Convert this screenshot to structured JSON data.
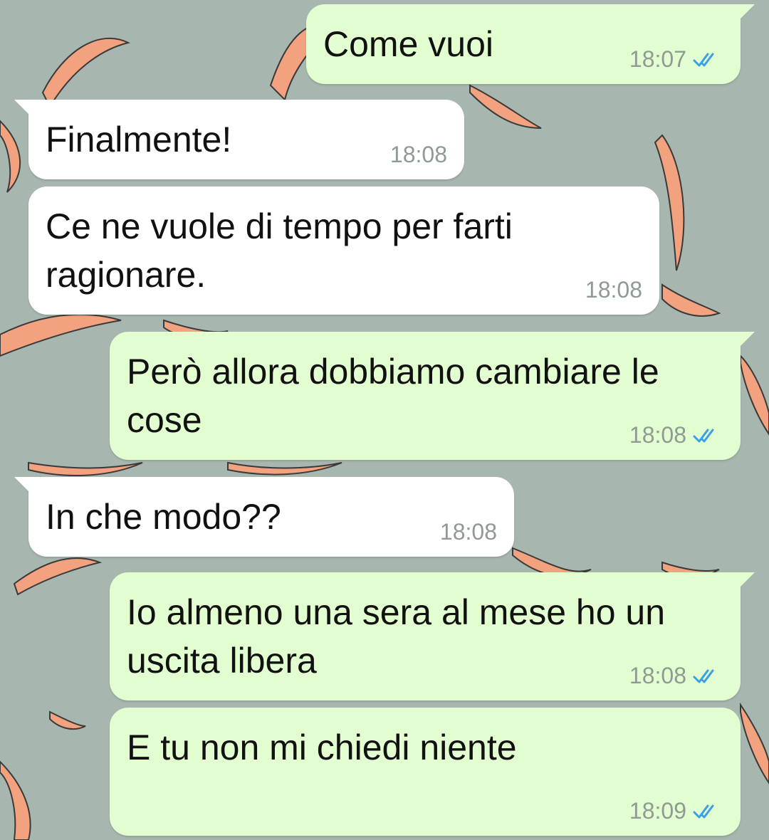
{
  "theme": {
    "wallpaper_color": "#a7b6ae",
    "incoming_bubble": "#ffffff",
    "outgoing_bubble": "#e2fdcf",
    "read_ticks_color": "#3aa0e6",
    "wallpaper_leaf_color": "#f2a27f"
  },
  "messages": [
    {
      "direction": "outgoing",
      "text": "Come vuoi",
      "time": "18:07",
      "status": "read"
    },
    {
      "direction": "incoming",
      "text": "Finalmente!",
      "time": "18:08"
    },
    {
      "direction": "incoming",
      "text": "Ce ne vuole di tempo per farti ragionare.",
      "time": "18:08"
    },
    {
      "direction": "outgoing",
      "text": "Però allora dobbiamo cambiare le cose",
      "time": "18:08",
      "status": "read"
    },
    {
      "direction": "incoming",
      "text": "In che modo??",
      "time": "18:08"
    },
    {
      "direction": "outgoing",
      "text": "Io almeno una sera al mese ho un uscita libera",
      "time": "18:08",
      "status": "read"
    },
    {
      "direction": "outgoing",
      "text": "E tu non mi chiedi niente",
      "time": "18:09",
      "status": "read"
    }
  ]
}
